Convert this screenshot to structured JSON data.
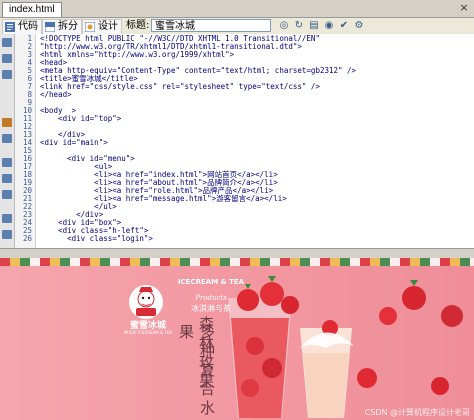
{
  "window": {
    "tab_label": "index.html",
    "close": "×"
  },
  "toolbar": {
    "code_label": "代码",
    "split_label": "拆分",
    "design_label": "设计",
    "title_label": "标题:",
    "title_value": "蜜雪冰城",
    "icons": [
      "globe-icon",
      "refresh-icon",
      "preview-icon",
      "eye-icon",
      "check-icon",
      "settings-icon"
    ]
  },
  "gutter": {
    "icons": [
      "collapse-icon",
      "expand-icon",
      "select-icon",
      "bookmark-icon",
      "comment-icon",
      "indent-icon",
      "outdent-icon",
      "format-icon",
      "wrap-icon",
      "tag-icon"
    ]
  },
  "editor": {
    "line_numbers": [
      "1",
      "2",
      "3",
      "4",
      "5",
      "6",
      "7",
      "8",
      "9",
      "10",
      "11",
      "12",
      "13",
      "14",
      "15",
      "16",
      "17",
      "18",
      "19",
      "20",
      "21",
      "22",
      "23",
      "24",
      "25",
      "26"
    ],
    "lines": [
      "<!DOCTYPE html PUBLIC \"-//W3C//DTD XHTML 1.0 Transitional//EN\"",
      "\"http://www.w3.org/TR/xhtml1/DTD/xhtml1-transitional.dtd\">",
      "<html xmlns=\"http://www.w3.org/1999/xhtml\">",
      "<head>",
      "<meta http-equiv=\"Content-Type\" content=\"text/html; charset=gb2312\" />",
      "<title>蜜雪冰城</title>",
      "<link href=\"css/style.css\" rel=\"stylesheet\" type=\"text/css\" />",
      "</head>",
      "",
      "<body  >",
      "    <div id=\"top\">",
      "",
      "    </div>",
      "<div id=\"main\">",
      "",
      "      <div id=\"menu\">",
      "            <ul>",
      "            <li><a href=\"index.html\">网站首页</a></li>",
      "            <li><a href=\"about.html\">品牌简介</a></li>",
      "            <li><a href=\"role.html\">品牌产品</a></li>",
      "            <li><a href=\"message.html\">游客留言</a></li>",
      "            </ul>",
      "        </div>",
      "    <div id=\"box\">",
      "    <div class=\"h-left\">",
      "      <div class=\"login\">"
    ]
  },
  "preview": {
    "logo_text": "蜜雪冰城",
    "logo_sub": "MIXUE ICECREAM & TEA",
    "ice_en": "ICECREAM & TEA",
    "products": "Products",
    "ice_cn": "冰淇淋与茶",
    "vertical_left": "多种复合水果",
    "vertical_right": "森林玫果",
    "watermark": "CSDN @计算机程序设计老哥"
  },
  "colors": {
    "accent": "#f39aa3",
    "code": "#000080",
    "linenum": "#3c5a9a"
  }
}
